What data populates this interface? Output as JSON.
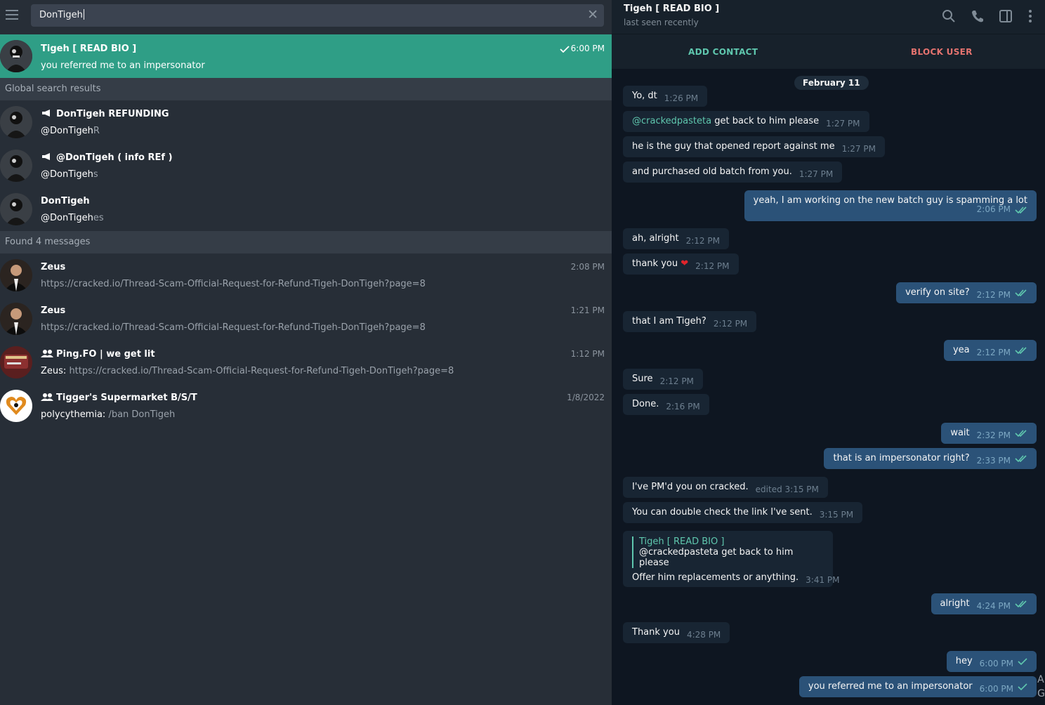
{
  "left": {
    "search": {
      "value": "DonTigeh"
    },
    "top_result": {
      "name": "Tigeh [ READ BIO ]",
      "preview": "you  referred me to an impersonator",
      "time": "6:00 PM"
    },
    "global_header": "Global search results",
    "global": [
      {
        "name": "DonTigeh REFUNDING",
        "handle_prefix": "@DonTigeh",
        "handle_suffix": "R"
      },
      {
        "name": "@DonTigeh ( info REf )",
        "handle_prefix": "@DonTigeh",
        "handle_suffix": "s"
      },
      {
        "name": "DonTigeh",
        "handle_prefix": "@DonTigeh",
        "handle_suffix": "es"
      }
    ],
    "messages_header": "Found 4 messages",
    "messages": [
      {
        "name": "Zeus",
        "time": "2:08 PM",
        "sender": "",
        "text": "https://cracked.io/Thread-Scam-Official-Request-for-Refund-Tigeh-DonTigeh?page=8"
      },
      {
        "name": "Zeus",
        "time": "1:21 PM",
        "sender": "",
        "text": "https://cracked.io/Thread-Scam-Official-Request-for-Refund-Tigeh-DonTigeh?page=8"
      },
      {
        "name": "Ping.FO | we get lit",
        "time": "1:12 PM",
        "sender": "Zeus: ",
        "text": "https://cracked.io/Thread-Scam-Official-Request-for-Refund-Tigeh-DonTigeh?page=8"
      },
      {
        "name": "Tigger's Supermarket B/S/T",
        "time": "1/8/2022",
        "sender": "polycythemia: ",
        "text": "/ban DonTigeh"
      }
    ]
  },
  "chat": {
    "name": "Tigeh [ READ BIO ]",
    "status": "last seen recently",
    "add_contact": "ADD CONTACT",
    "block_user": "BLOCK USER",
    "date": "February 11",
    "colors": {
      "accent": "#5fc7ae",
      "danger": "#e5736f",
      "out_bubble": "#2b5278",
      "in_bubble": "#182533"
    },
    "m": [
      {
        "text": "Yo, dt",
        "time": "1:26 PM"
      },
      {
        "mention": "@crackedpasteta",
        "text": " get back to him please",
        "time": "1:27 PM"
      },
      {
        "text": "he is the guy that opened report against me",
        "time": "1:27 PM"
      },
      {
        "text": "and purchased old batch from you.",
        "time": "1:27 PM"
      },
      {
        "text": "yeah, I am working on the new batch guy is spamming a lot",
        "time": "2:06 PM"
      },
      {
        "text": "ah, alright",
        "time": "2:12 PM"
      },
      {
        "text": "thank you",
        "time": "2:12 PM"
      },
      {
        "text": "verify on site?",
        "time": "2:12 PM"
      },
      {
        "text": "that I am Tigeh?",
        "time": "2:12 PM"
      },
      {
        "text": "yea",
        "time": "2:12 PM"
      },
      {
        "text": "Sure",
        "time": "2:12 PM"
      },
      {
        "text": "Done.",
        "time": "2:16 PM"
      },
      {
        "text": "wait",
        "time": "2:32 PM"
      },
      {
        "text": "that is an impersonator right?",
        "time": "2:33 PM"
      },
      {
        "text": "I've PM'd you on cracked.",
        "time": "edited 3:15 PM"
      },
      {
        "text": "You can double check the link I've sent.",
        "time": "3:15 PM"
      },
      {
        "reply_name": "Tigeh [ READ BIO ]",
        "reply_text": "@crackedpasteta get back to him please",
        "text": "Offer him replacements or anything.",
        "time": "3:41 PM"
      },
      {
        "text": "alright",
        "time": "4:24 PM"
      },
      {
        "text": "Thank you",
        "time": "4:28 PM"
      },
      {
        "text": "hey",
        "time": "6:00 PM"
      },
      {
        "text": "you  referred me to an impersonator",
        "time": "6:00 PM"
      }
    ],
    "corner_text": "A\nG"
  }
}
